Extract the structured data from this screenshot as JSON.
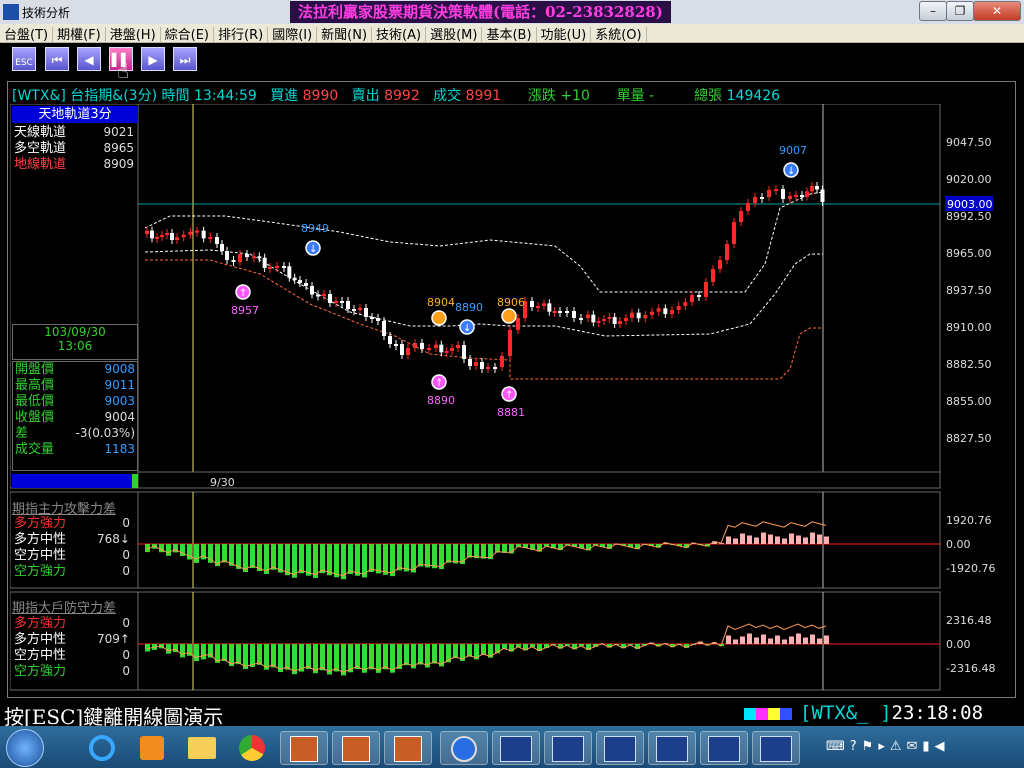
{
  "window": {
    "title": "技術分析",
    "promo": "法拉利贏家股票期貨決策軟體(電話：02-23832828)"
  },
  "menu": [
    "台盤(T)",
    "期權(F)",
    "港盤(H)",
    "綜合(E)",
    "排行(R)",
    "國際(I)",
    "新聞(N)",
    "技術(A)",
    "選股(M)",
    "基本(B)",
    "功能(U)",
    "系統(O)"
  ],
  "toolbar": {
    "esc_label": "ESC"
  },
  "quote": {
    "symbol": "[WTX&]",
    "name": "台指期&(3分)",
    "time_label": "時間",
    "time": "13:44:59",
    "bid_label": "買進",
    "bid": "8990",
    "ask_label": "賣出",
    "ask": "8992",
    "deal_label": "成交",
    "deal": "8991",
    "change_label": "漲跌",
    "change": "+10",
    "vol_label": "單量",
    "vol": "-",
    "total_label": "總張",
    "total": "149426"
  },
  "main_panel": {
    "title": "天地軌道3分",
    "tracks": [
      {
        "name": "天線軌道",
        "value": "9021",
        "color": "#ffffff"
      },
      {
        "name": "多空軌道",
        "value": "8965",
        "color": "#ffffff"
      },
      {
        "name": "地線軌道",
        "value": "8909",
        "color": "#ff4040"
      }
    ],
    "date": "103/09/30",
    "time": "13:06",
    "stats": [
      {
        "name": "開盤價",
        "value": "9008"
      },
      {
        "name": "最高價",
        "value": "9011"
      },
      {
        "name": "最低價",
        "value": "9003"
      },
      {
        "name": "收盤價",
        "value": "9004"
      },
      {
        "name": "差",
        "value": "-3(0.03%)"
      },
      {
        "name": "成交量",
        "value": "1183"
      }
    ],
    "x_label": "9/30",
    "y_ticks": [
      "9047.50",
      "9020.00",
      "8992.50",
      "8965.00",
      "8937.50",
      "8910.00",
      "8882.50",
      "8855.00",
      "8827.50"
    ],
    "last_price": "9003.00",
    "markers": [
      {
        "label": "9007",
        "type": "sell"
      },
      {
        "label": "8949",
        "type": "sell"
      },
      {
        "label": "8957",
        "type": "buy"
      },
      {
        "label": "8904",
        "type": "neutral"
      },
      {
        "label": "8890",
        "type": "sell"
      },
      {
        "label": "8906",
        "type": "neutral"
      },
      {
        "label": "8890",
        "type": "buy"
      },
      {
        "label": "8881",
        "type": "buy"
      }
    ]
  },
  "indicator1": {
    "title": "期指主力攻擊力差",
    "rows": [
      {
        "name": "多方強力",
        "value": "0",
        "color": "#ff3030"
      },
      {
        "name": "多方中性",
        "value": "768↓",
        "color": "#ffffff"
      },
      {
        "name": "空方中性",
        "value": "0",
        "color": "#ffffff"
      },
      {
        "name": "空方強力",
        "value": "0",
        "color": "#30d030"
      }
    ],
    "y_ticks": [
      "1920.76",
      "0.00",
      "-1920.76"
    ]
  },
  "indicator2": {
    "title": "期指大戶防守力差",
    "rows": [
      {
        "name": "多方強力",
        "value": "0",
        "color": "#ff3030"
      },
      {
        "name": "多方中性",
        "value": "709↑",
        "color": "#ffffff"
      },
      {
        "name": "空方中性",
        "value": "0",
        "color": "#ffffff"
      },
      {
        "name": "空方強力",
        "value": "0",
        "color": "#30d030"
      }
    ],
    "y_ticks": [
      "2316.48",
      "0.00",
      "-2316.48"
    ]
  },
  "statusbar": {
    "hint": "按[ESC]鍵離開線圖演示",
    "symbol": "[WTX&_ ]",
    "clock": "23:18:08"
  },
  "colors": {
    "up": "#ff2a2a",
    "down": "#ffffff",
    "bull_bar": "#ffb0b0",
    "bear_bar": "#33dd33",
    "track_line": "#ffffff",
    "ground_line": "#ff6a3a",
    "cyan": "#00d7d7"
  }
}
